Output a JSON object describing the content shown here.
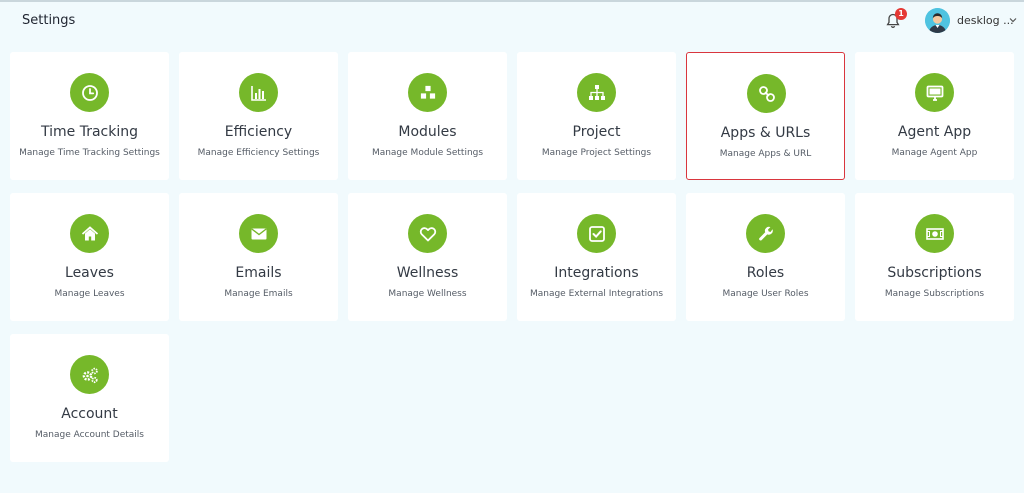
{
  "header": {
    "title": "Settings",
    "notification_count": "1",
    "user_name": "desklog ..."
  },
  "cards": [
    {
      "title": "Time Tracking",
      "subtitle": "Manage Time Tracking Settings",
      "icon": "clock-icon"
    },
    {
      "title": "Efficiency",
      "subtitle": "Manage Efficiency Settings",
      "icon": "bar-chart-icon"
    },
    {
      "title": "Modules",
      "subtitle": "Manage Module Settings",
      "icon": "cubes-icon"
    },
    {
      "title": "Project",
      "subtitle": "Manage Project Settings",
      "icon": "sitemap-icon"
    },
    {
      "title": "Apps & URLs",
      "subtitle": "Manage Apps & URL",
      "icon": "link-icon",
      "selected": true
    },
    {
      "title": "Agent App",
      "subtitle": "Manage Agent App",
      "icon": "monitor-icon"
    },
    {
      "title": "Leaves",
      "subtitle": "Manage Leaves",
      "icon": "home-icon"
    },
    {
      "title": "Emails",
      "subtitle": "Manage Emails",
      "icon": "envelope-icon"
    },
    {
      "title": "Wellness",
      "subtitle": "Manage Wellness",
      "icon": "heart-icon"
    },
    {
      "title": "Integrations",
      "subtitle": "Manage External Integrations",
      "icon": "check-square-icon"
    },
    {
      "title": "Roles",
      "subtitle": "Manage User Roles",
      "icon": "wrench-icon"
    },
    {
      "title": "Subscriptions",
      "subtitle": "Manage Subscriptions",
      "icon": "money-icon"
    },
    {
      "title": "Account",
      "subtitle": "Manage Account Details",
      "icon": "gears-icon"
    }
  ],
  "colors": {
    "accent": "#76b82a",
    "selected_border": "#d9363e",
    "background": "#f1fafd",
    "badge": "#e53935"
  }
}
